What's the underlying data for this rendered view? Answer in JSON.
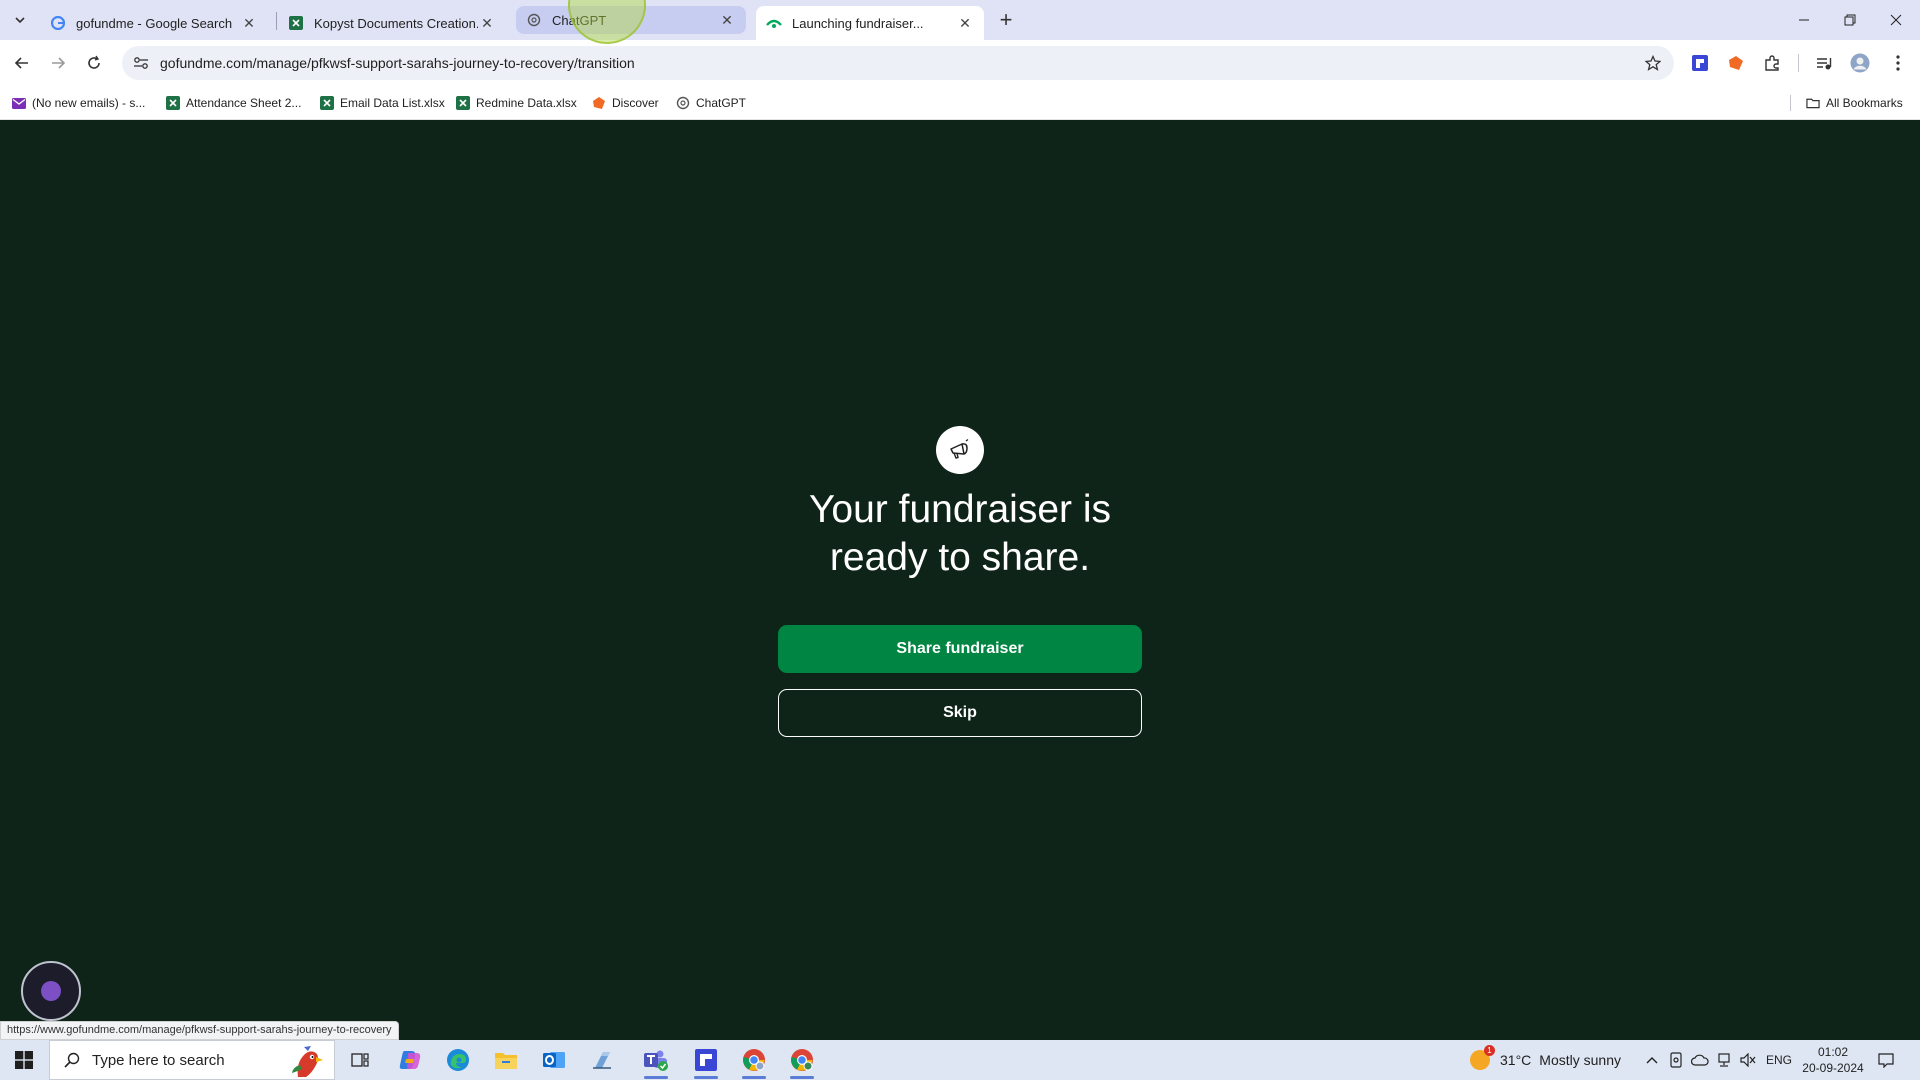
{
  "browser": {
    "tabs": [
      {
        "title": "gofundme - Google Search",
        "favicon": "google-icon"
      },
      {
        "title": "Kopyst Documents Creation.xlsx",
        "favicon": "excel-icon"
      },
      {
        "title": "ChatGPT",
        "favicon": "chatgpt-icon"
      },
      {
        "title": "Launching fundraiser...",
        "favicon": "gofundme-icon"
      }
    ],
    "active_tab_index": 3,
    "url": "gofundme.com/manage/pfkwsf-support-sarahs-journey-to-recovery/transition",
    "bookmarks": [
      {
        "label": "(No new emails) - s...",
        "icon": "mail-icon"
      },
      {
        "label": "Attendance Sheet 2...",
        "icon": "excel-icon"
      },
      {
        "label": "Email Data List.xlsx",
        "icon": "excel-icon"
      },
      {
        "label": "Redmine Data.xlsx",
        "icon": "excel-icon"
      },
      {
        "label": "Discover",
        "icon": "discover-icon"
      },
      {
        "label": "ChatGPT",
        "icon": "chatgpt-icon"
      }
    ],
    "all_bookmarks_label": "All Bookmarks",
    "status_url": "https://www.gofundme.com/manage/pfkwsf-support-sarahs-journey-to-recovery"
  },
  "page": {
    "headline_line1": "Your fundraiser is",
    "headline_line2": "ready to share.",
    "share_button": "Share fundraiser",
    "skip_button": "Skip"
  },
  "taskbar": {
    "search_placeholder": "Type here to search",
    "weather_temp": "31°C",
    "weather_desc": "Mostly sunny",
    "weather_badge": "1",
    "language": "ENG",
    "time": "01:02",
    "date": "20-09-2024"
  },
  "colors": {
    "page_bg": "#0f2419",
    "share_green": "#008542",
    "tabstrip_bg": "#dfe3f5"
  }
}
